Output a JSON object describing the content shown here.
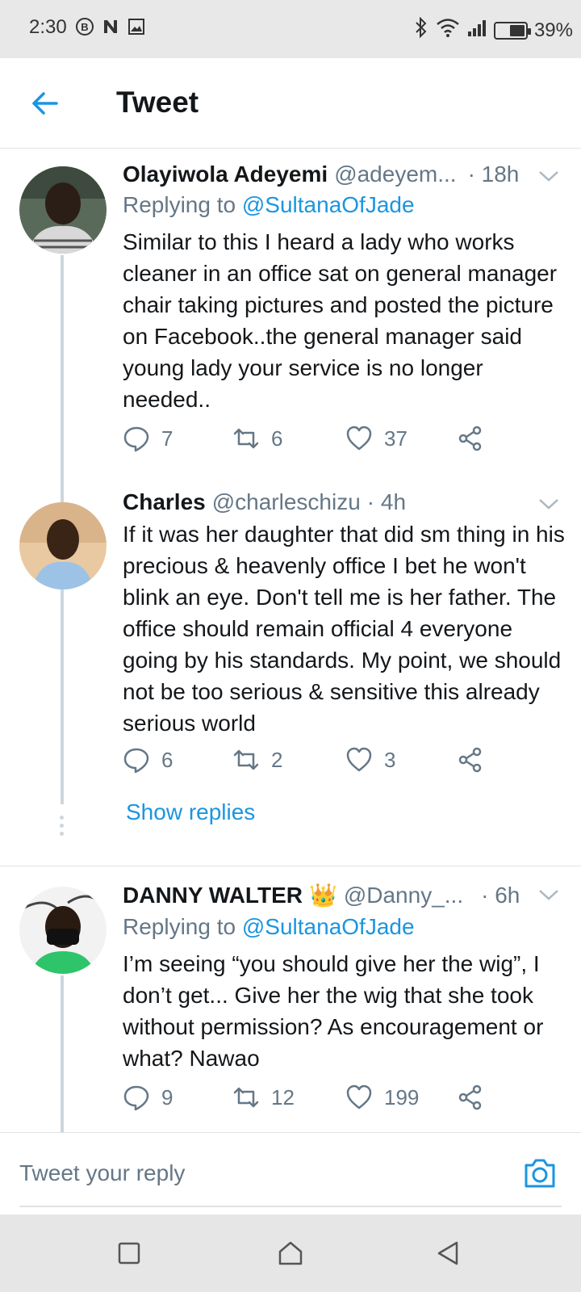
{
  "status_bar": {
    "time": "2:30",
    "battery": "39%",
    "left_icons": [
      "b-circle-icon",
      "n-icon",
      "image-icon"
    ],
    "right_icons": [
      "bluetooth-icon",
      "wifi-icon",
      "signal-icon",
      "battery-charging-icon"
    ]
  },
  "header": {
    "title": "Tweet"
  },
  "tweets": [
    {
      "name": "Olayiwola Adeyemi",
      "handle": "@adeyem...",
      "time": "· 18h",
      "replying_label": "Replying to",
      "replying_to": "@SultanaOfJade",
      "text": "Similar to this I heard a lady who works cleaner in an office sat on general manager chair taking pictures and posted the picture on Facebook..the general manager said young lady your service is no longer needed..",
      "replies": "7",
      "retweets": "6",
      "likes": "37"
    },
    {
      "name": "Charles",
      "handle": "@charleschizu",
      "time": "· 4h",
      "text": "If it was her daughter that did sm thing in his precious & heavenly office I bet he won't blink an eye. Don't tell me is her father. The office should remain official 4 everyone going by his standards. My point, we should not be too serious & sensitive this already serious world",
      "replies": "6",
      "retweets": "2",
      "likes": "3",
      "show_replies": "Show replies"
    },
    {
      "name": "DANNY WALTER",
      "badge": "👑",
      "handle": "@Danny_...",
      "time": "· 6h",
      "replying_label": "Replying to",
      "replying_to": "@SultanaOfJade",
      "text": "I’m seeing “you should give her the wig”, I don’t get... Give her the wig that she took without permission? As encouragement or what? Nawao",
      "replies": "9",
      "retweets": "12",
      "likes": "199"
    }
  ],
  "reply_bar": {
    "placeholder": "Tweet your reply"
  },
  "colors": {
    "accent": "#1b95e0",
    "muted": "#657786",
    "text": "#14171a",
    "thread_line": "#ccd6dd"
  }
}
